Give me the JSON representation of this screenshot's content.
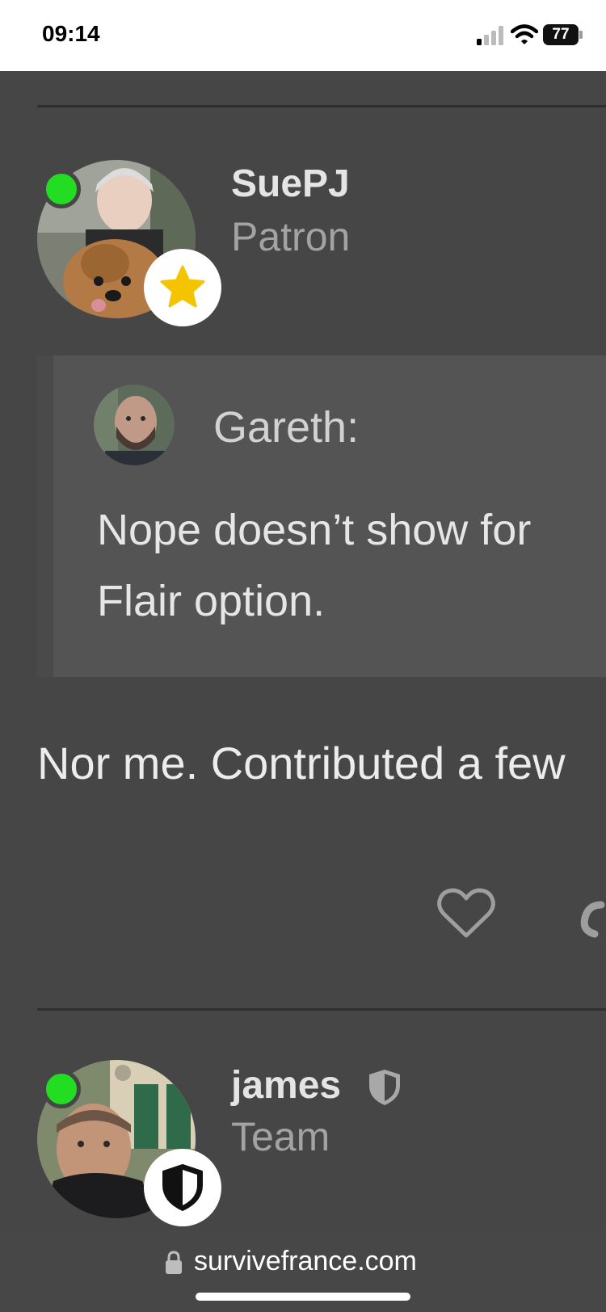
{
  "status_bar": {
    "time": "09:14",
    "battery": "77",
    "icons": [
      "signal-icon",
      "wifi-icon",
      "battery-icon"
    ]
  },
  "post1": {
    "username": "SuePJ",
    "title": "Patron",
    "badge_icon": "star-icon",
    "badge_color": "#f5c400",
    "online_color": "#22dd22",
    "quote": {
      "author": "Gareth:",
      "line1": "Nope doesn’t show for",
      "line2": "Flair option."
    },
    "text": "Nor me. Contributed a few",
    "actions": [
      "like-icon",
      "link-icon"
    ]
  },
  "post2": {
    "username": "james",
    "title": "Team",
    "badge_icon": "shield-icon",
    "online_color": "#22dd22"
  },
  "browser": {
    "url": "survivefrance.com",
    "icons": [
      "lock-icon"
    ]
  }
}
